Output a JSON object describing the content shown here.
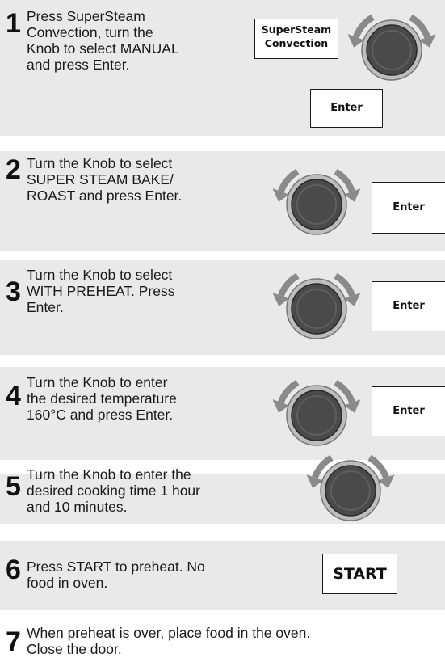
{
  "steps": [
    {
      "number": "1",
      "text": "Press SuperSteam\nConvection, turn the\nKnob to select MANUAL\nand press Enter.",
      "buttons": [
        "SuperSteam\nConvection",
        "Enter"
      ]
    },
    {
      "number": "2",
      "text": "Turn the Knob to select\nSUPER STEAM BAKE/\nROAST and press Enter.",
      "buttons": [
        "Enter"
      ]
    },
    {
      "number": "3",
      "text": "Turn the Knob to select\nWITH PREHEAT. Press\nEnter.",
      "buttons": [
        "Enter"
      ]
    },
    {
      "number": "4",
      "text": "Turn the Knob to enter\nthe desired temperature\n160°C and press Enter.",
      "buttons": [
        "Enter"
      ]
    },
    {
      "number": "5",
      "text": "Turn the Knob to enter the\ndesired cooking time 1 hour\nand 10 minutes.",
      "buttons": []
    },
    {
      "number": "6",
      "text": "Press START to preheat. No\nfood in oven.",
      "buttons": [
        "START"
      ]
    },
    {
      "number": "7",
      "text": "When preheat is over, place food in the oven.\nClose the door.",
      "buttons": []
    }
  ],
  "icons": {
    "knob": "rotary-knob-icon",
    "arrows": "rotation-arrows-icon"
  },
  "colors": {
    "panel": "#e9e9e9",
    "knob_body": "#4a4a4a",
    "knob_ring": "#bdbdbd",
    "arrow": "#8a8a8a"
  }
}
